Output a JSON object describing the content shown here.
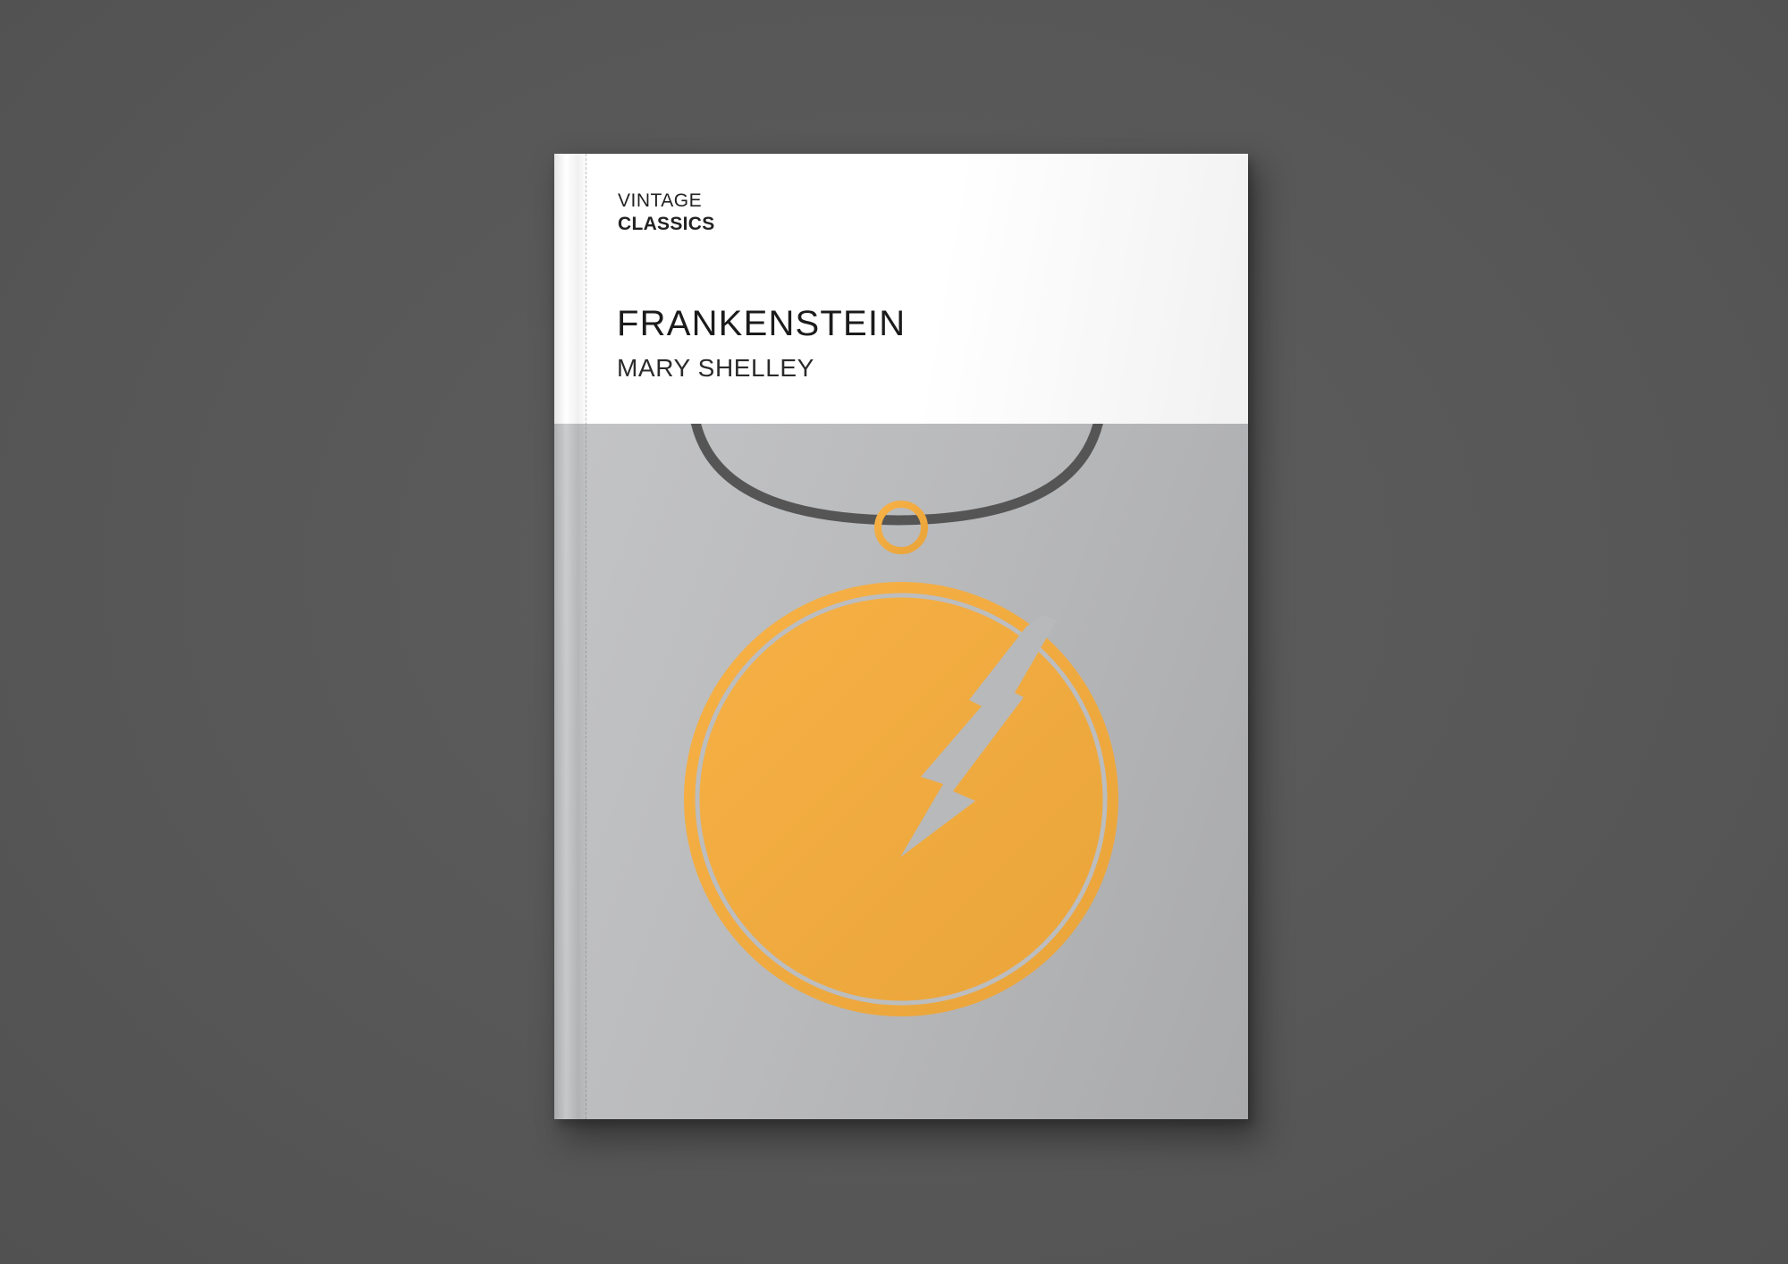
{
  "scene": {
    "background_color": "#595959",
    "cover_top_color": "#ffffff",
    "cover_bottom_color": "#b9babc",
    "pendant_color": "#f4a93d",
    "cord_color": "#555555",
    "illustration_icons": [
      "necklace-cord-icon",
      "pendant-ring-icon",
      "pendant-medallion-icon",
      "lightning-bolt-icon"
    ]
  },
  "cover": {
    "imprint_line1": "VINTAGE",
    "imprint_line2": "CLASSICS",
    "title": "FRANKENSTEIN",
    "author": "MARY SHELLEY"
  }
}
